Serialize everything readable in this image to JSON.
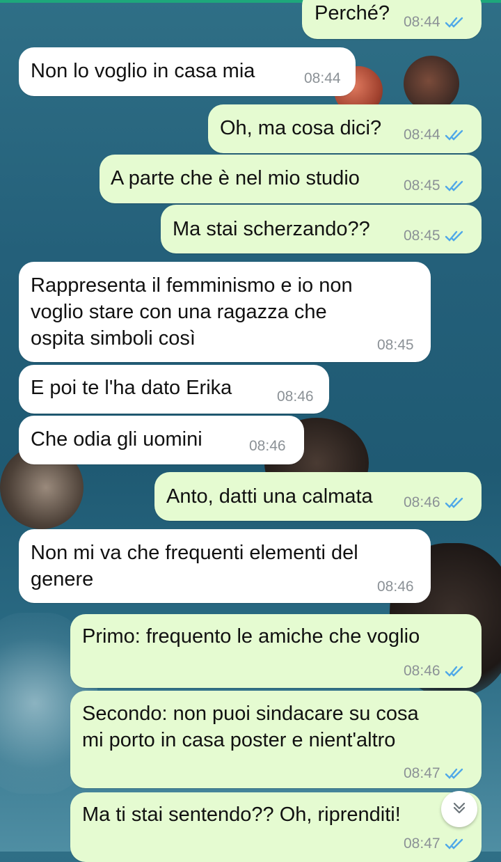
{
  "messages": [
    {
      "text": "Perché?",
      "time": "08:44",
      "dir": "out",
      "status": "read"
    },
    {
      "text": "Non lo voglio in casa mia",
      "time": "08:44",
      "dir": "in"
    },
    {
      "text": "Oh, ma cosa dici?",
      "time": "08:44",
      "dir": "out",
      "status": "read"
    },
    {
      "text": "A parte che è nel mio studio",
      "time": "08:45",
      "dir": "out",
      "status": "read"
    },
    {
      "text": "Ma stai scherzando??",
      "time": "08:45",
      "dir": "out",
      "status": "read"
    },
    {
      "lines": [
        "Rappresenta il femminismo e io non",
        "voglio stare con una ragazza che",
        "ospita simboli così"
      ],
      "time": "08:45",
      "dir": "in"
    },
    {
      "text": "E poi te l'ha dato Erika",
      "time": "08:46",
      "dir": "in"
    },
    {
      "text": "Che odia gli uomini",
      "time": "08:46",
      "dir": "in"
    },
    {
      "text": "Anto, datti una calmata",
      "time": "08:46",
      "dir": "out",
      "status": "read"
    },
    {
      "lines": [
        "Non mi va che frequenti elementi del",
        "genere"
      ],
      "time": "08:46",
      "dir": "in"
    },
    {
      "text": "Primo: frequento le amiche che voglio",
      "time": "08:46",
      "dir": "out",
      "status": "read"
    },
    {
      "lines": [
        "Secondo: non puoi sindacare su cosa",
        "mi porto in casa poster e nient'altro"
      ],
      "time": "08:47",
      "dir": "out",
      "status": "read"
    },
    {
      "text": "Ma ti stai sentendo?? Oh, riprenditi!",
      "time": "08:47",
      "dir": "out",
      "status": "read"
    }
  ],
  "colors": {
    "incoming_bubble": "#ffffff",
    "outgoing_bubble": "#e5fbd1",
    "read_tick": "#4fa8e8",
    "timestamp": "#8b9196"
  },
  "icons": {
    "read_receipt": "double-check-icon",
    "scroll_down": "chevron-double-down-icon"
  }
}
